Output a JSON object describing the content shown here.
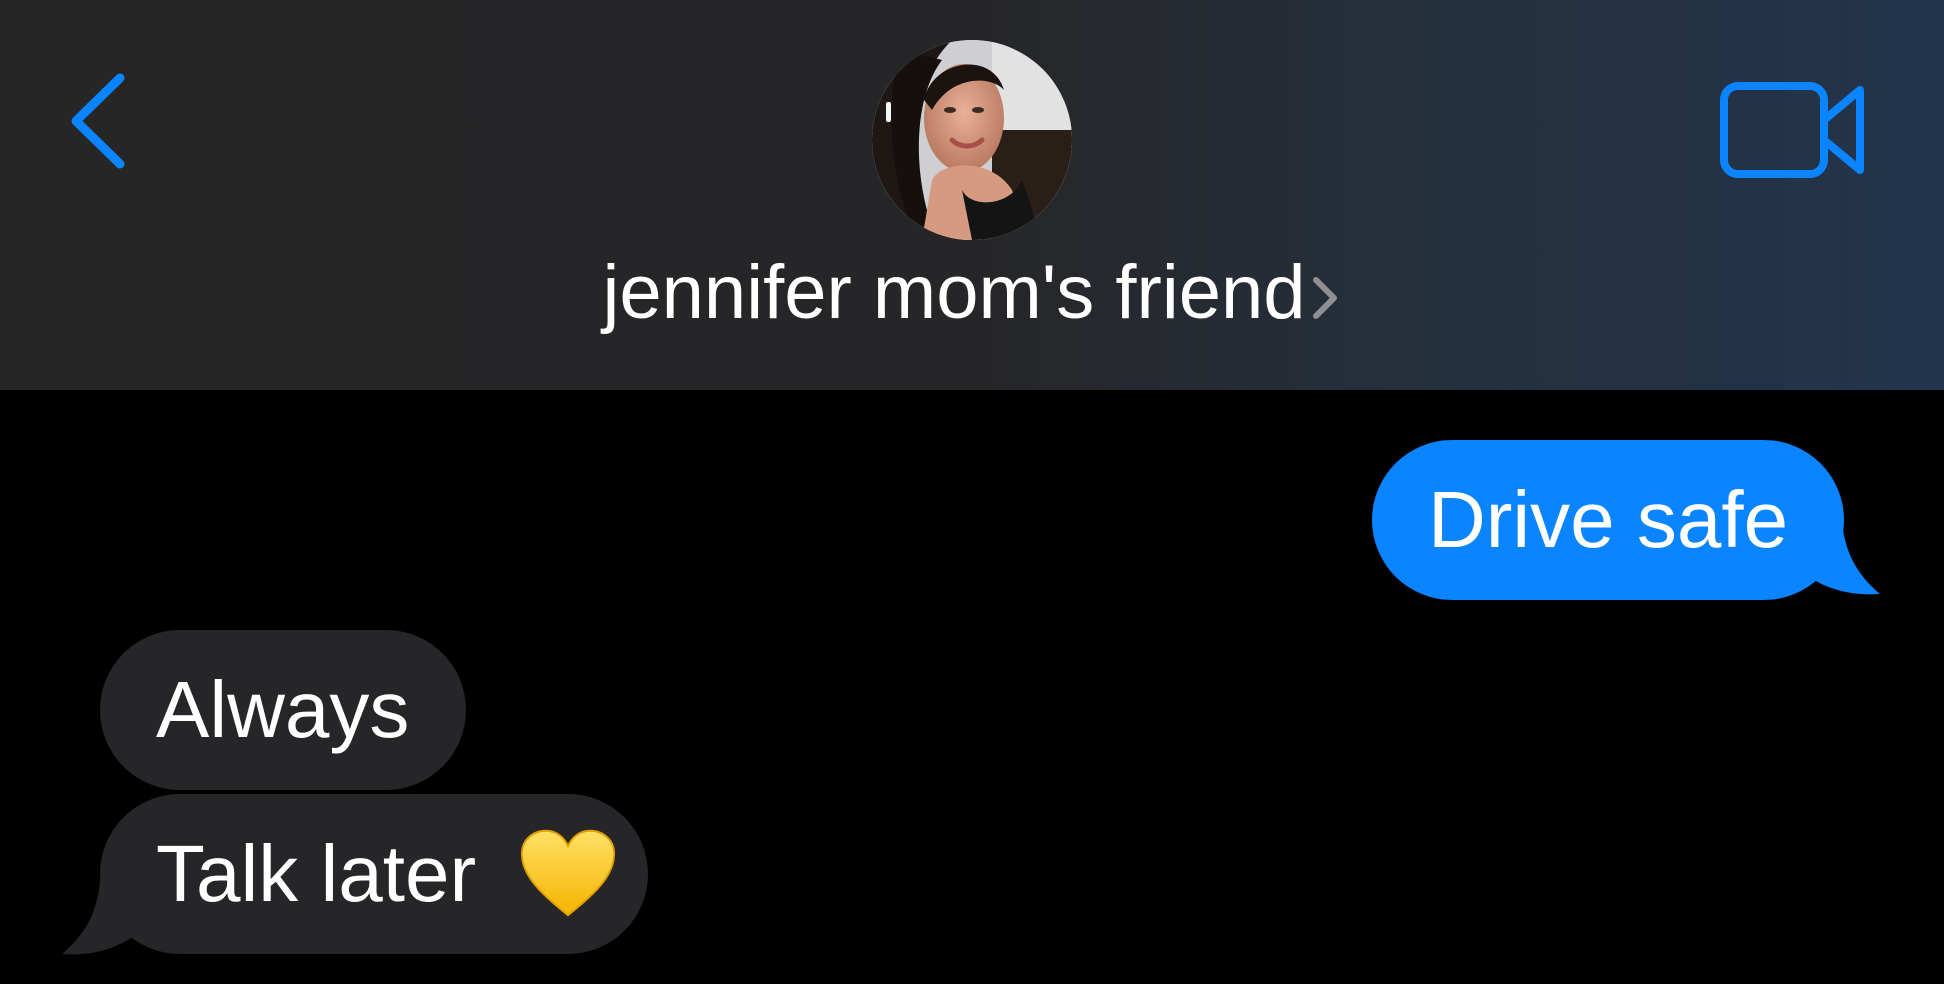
{
  "header": {
    "contact_name": "jennifer mom's friend",
    "avatar_icon": "contact-photo",
    "back_icon": "chevron-left-icon",
    "video_icon": "video-camera-icon",
    "disclosure_icon": "chevron-right-icon"
  },
  "messages": [
    {
      "direction": "outgoing",
      "text": "Drive safe"
    },
    {
      "direction": "incoming",
      "text": "Always"
    },
    {
      "direction": "incoming",
      "text": "Talk later",
      "emoji": "yellow-heart"
    }
  ],
  "colors": {
    "accent": "#0a84ff",
    "outgoing_bubble": "#0a84ff",
    "incoming_bubble": "#262629",
    "background": "#000000",
    "header_bg": "#262627"
  }
}
